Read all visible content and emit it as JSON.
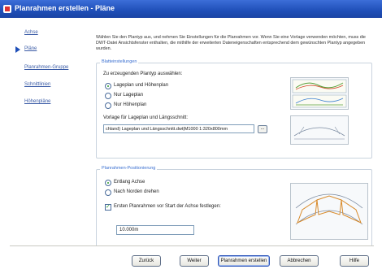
{
  "window": {
    "title": "Planrahmen erstellen - Pläne"
  },
  "nav": {
    "items": [
      {
        "label": "Achse"
      },
      {
        "label": "Pläne"
      },
      {
        "label": "Planrahmen-Gruppe"
      },
      {
        "label": "Schnittlinien"
      },
      {
        "label": "Höhenpläne"
      }
    ]
  },
  "intro_text": "Wählen Sie den Plantyp aus, und nehmen Sie Einstellungen für die Planrahmen vor. Wenn Sie eine Vorlage verwenden möchten, muss die DWT-Datei Ansichtsfenster enthalten, die mithilfe der erweiterten Dateneigenschaften entsprechend dem gewünschten Plantyp angegeben wurden.",
  "sheet_settings": {
    "group_label": "Blatteinstellungen",
    "prompt": "Zu erzeugenden Plantyp auswählen:",
    "options": [
      {
        "label": "Lageplan und Höhenplan",
        "selected": true
      },
      {
        "label": "Nur Lageplan",
        "selected": false
      },
      {
        "label": "Nur Höhenplan",
        "selected": false
      }
    ],
    "template_label": "Vorlage für Lageplan und Längsschnitt:",
    "template_value": "chland) Lageplan und Längsschnitt.dwt|M1000 1:320x800mm",
    "browse_label": "..."
  },
  "positioning": {
    "group_label": "Planrahmen-Positionierung",
    "options": [
      {
        "label": "Entlang Achse",
        "selected": true
      },
      {
        "label": "Nach Norden drehen",
        "selected": false
      }
    ],
    "checkbox": {
      "label": "Ersten Planrahmen vor Start der Achse festlegen:",
      "checked": true
    },
    "distance_value": "10.000m"
  },
  "buttons": {
    "back": "Zurück",
    "next": "Weiter",
    "create": "Planrahmen erstellen",
    "cancel": "Abbrechen",
    "help": "Hilfe"
  },
  "colors": {
    "title_bar": "#1f4fb8",
    "accent": "#3a6fd0",
    "link": "#3a5ba6"
  }
}
